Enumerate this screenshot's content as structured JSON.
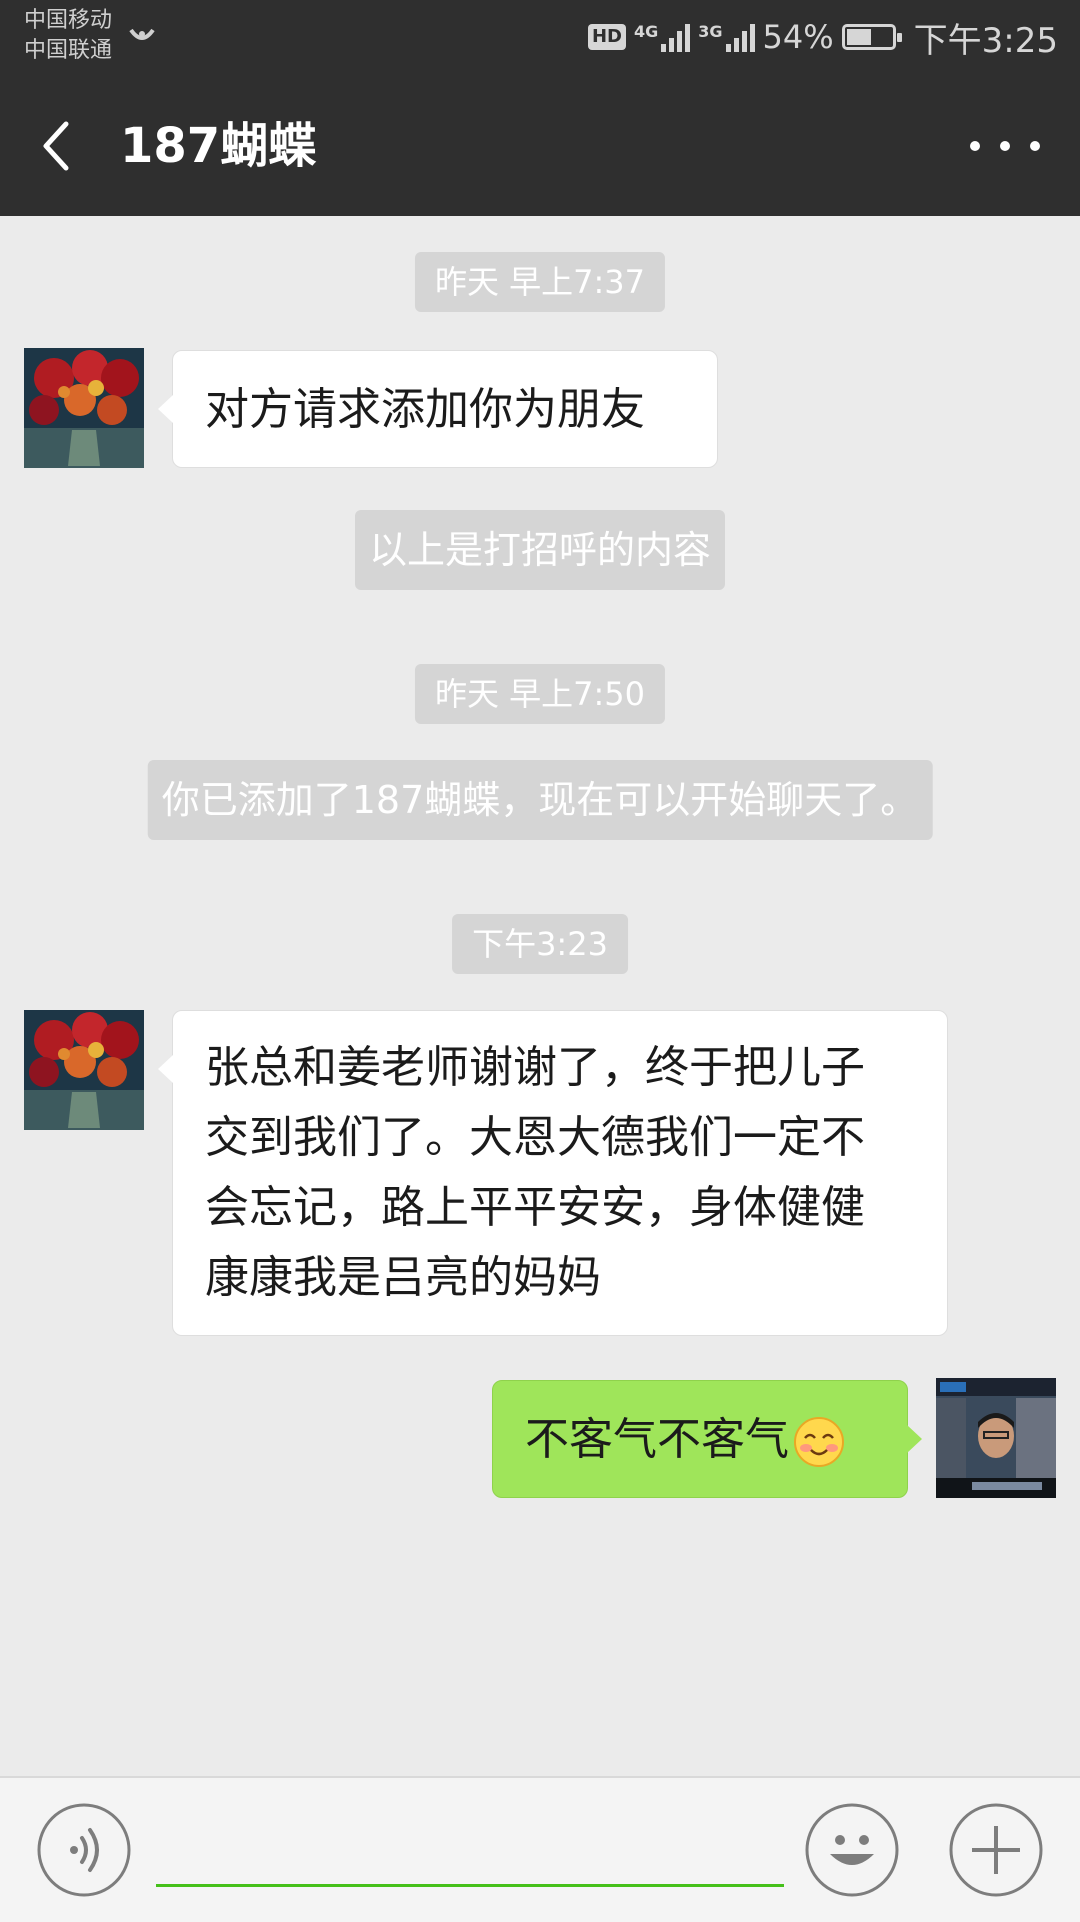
{
  "status_bar": {
    "carrier_1": "中国移动",
    "carrier_2": "中国联通",
    "hd_label": "HD",
    "network_1": "4G",
    "network_2": "3G",
    "battery_percent": "54%",
    "battery_level": 0.54,
    "time": "下午3:25"
  },
  "header": {
    "back_icon": "chevron-left-icon",
    "title": "187蝴蝶",
    "more_icon": "more-dots-icon"
  },
  "messages": {
    "ts_1": "昨天 早上7:37",
    "msg_1": "对方请求添加你为朋友",
    "sys_1": "以上是打招呼的内容",
    "ts_2": "昨天 早上7:50",
    "sys_2": "你已添加了187蝴蝶，现在可以开始聊天了。",
    "ts_3": "下午3:23",
    "msg_2_lines": [
      "张总和姜老师谢谢了，终于把儿子",
      "交到我们了。大恩大德我们一定不",
      "会忘记，路上平平安安，身体健健",
      "康康我是吕亮的妈妈"
    ],
    "msg_3": "不客气不客气"
  },
  "input_bar": {
    "voice_icon": "voice-icon",
    "emoji_icon": "emoji-icon",
    "plus_icon": "plus-icon",
    "input_value": ""
  },
  "colors": {
    "header_bg": "#2f2f2f",
    "chat_bg": "#ebebeb",
    "sent_bubble": "#9fe55a",
    "input_accent": "#45c01a"
  }
}
